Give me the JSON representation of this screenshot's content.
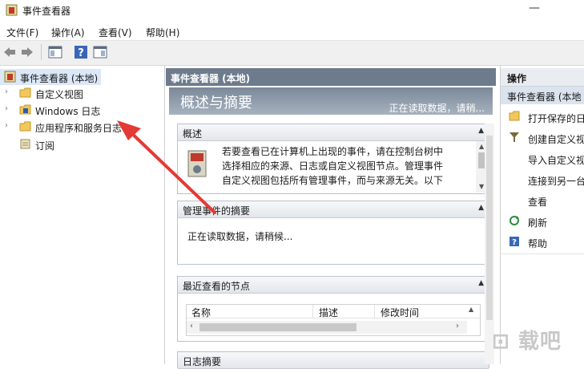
{
  "window": {
    "title": "事件查看器",
    "minimize": "—"
  },
  "menu": [
    {
      "label": "文件(F)"
    },
    {
      "label": "操作(A)"
    },
    {
      "label": "查看(V)"
    },
    {
      "label": "帮助(H)"
    }
  ],
  "tree": {
    "items": [
      {
        "label": "事件查看器 (本地)",
        "icon": "event-viewer-icon",
        "selected": true
      },
      {
        "label": "自定义视图",
        "icon": "folder-icon"
      },
      {
        "label": "Windows 日志",
        "icon": "log-folder-icon"
      },
      {
        "label": "应用程序和服务日志",
        "icon": "folder-icon"
      },
      {
        "label": "订阅",
        "icon": "subscription-icon"
      }
    ]
  },
  "center": {
    "header": "事件查看器 (本地)",
    "banner_title": "概述与摘要",
    "banner_status": "正在读取数据，请稍...",
    "overview": {
      "title": "概述",
      "lines": [
        "若要查看已在计算机上出现的事件，请在控制台树中",
        "选择相应的来源、日志或自定义视图节点。管理事件",
        "自定义视图包括所有管理事件，而与来源无关。以下"
      ]
    },
    "summary": {
      "title": "管理事件的摘要",
      "text": "正在读取数据，请稍候..."
    },
    "recent": {
      "title": "最近查看的节点",
      "columns": [
        "名称",
        "描述",
        "修改时间"
      ]
    },
    "log_summary": {
      "title": "日志摘要"
    }
  },
  "actions": {
    "header": "操作",
    "subheader": "事件查看器 (本地",
    "items": [
      {
        "label": "打开保存的日",
        "icon": "open-folder-icon"
      },
      {
        "label": "创建自定义视",
        "icon": "filter-icon"
      },
      {
        "label": "导入自定义视",
        "icon": ""
      },
      {
        "label": "连接到另一台",
        "icon": ""
      },
      {
        "label": "查看",
        "icon": ""
      },
      {
        "label": "刷新",
        "icon": "refresh-icon"
      },
      {
        "label": "帮助",
        "icon": "help-icon"
      }
    ]
  },
  "colors": {
    "header": "#6d7b8d",
    "arrow": "#e53935",
    "selection": "#dbe8f8"
  }
}
